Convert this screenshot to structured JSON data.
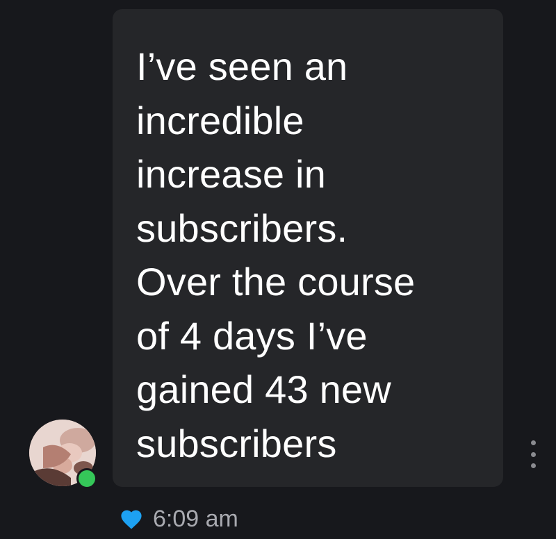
{
  "message": {
    "lines": [
      "I’ve seen an",
      "incredible",
      "increase in",
      "subscribers.",
      "Over the course",
      "of 4 days I’ve",
      "gained 43 new",
      "subscribers"
    ],
    "timestamp": "6:09 am",
    "liked": true
  },
  "sender": {
    "online": true
  },
  "colors": {
    "background": "#17181c",
    "bubble": "#252629",
    "message_text": "#ffffff",
    "timestamp_text": "#a9aab0",
    "heart": "#1da1f2",
    "online_indicator": "#35c759"
  },
  "icons": {
    "like": "heart-icon",
    "more": "more-options-icon",
    "status": "online-status-icon"
  }
}
